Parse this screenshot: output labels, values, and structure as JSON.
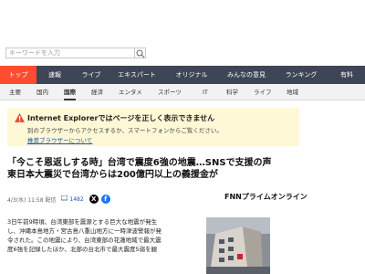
{
  "search": {
    "placeholder": "キーワードを入力"
  },
  "nav": {
    "tabs": [
      "トップ",
      "速報",
      "ライブ",
      "エキスパート",
      "オリジナル",
      "みんなの意見",
      "ランキング",
      "有料"
    ]
  },
  "subnav": {
    "items": [
      "主要",
      "国内",
      "国際",
      "経済",
      "エンタメ",
      "スポーツ",
      "IT",
      "科学",
      "ライフ",
      "地域"
    ]
  },
  "notice": {
    "title": "Internet Explorerではページを正しく表示できません",
    "body": "別のブラウザーからアクセスするか、スマートフォンからご覧ください。",
    "link": "推奨ブラウザーについて"
  },
  "article": {
    "headline_lines": [
      "「今こそ恩返しする時」台湾で震度6強の地震…SNSで支援の声",
      "東日本大震災で台湾からは200億円以上の義援金が"
    ],
    "datetime": "4/3(水) 11:58 配信",
    "comments": "1482",
    "source_logo": "FNNプライムオンライン",
    "body_lines": [
      "3日午前9時頃、台湾東部を震源とする巨大な地震が発生",
      "し、沖縄本島地方・宮古島八重山地方に一時津波警報が発",
      "令された。この地震により、台湾東部の花蓮地域で最大震",
      "度6強を記録したほか、北部の台北市で最大震度5弱を観"
    ]
  },
  "colors": {
    "nav_bg": "#3d4556",
    "nav_active": "#ff4c2f",
    "notice_bg": "#fff8d6",
    "link": "#1a57a8"
  }
}
